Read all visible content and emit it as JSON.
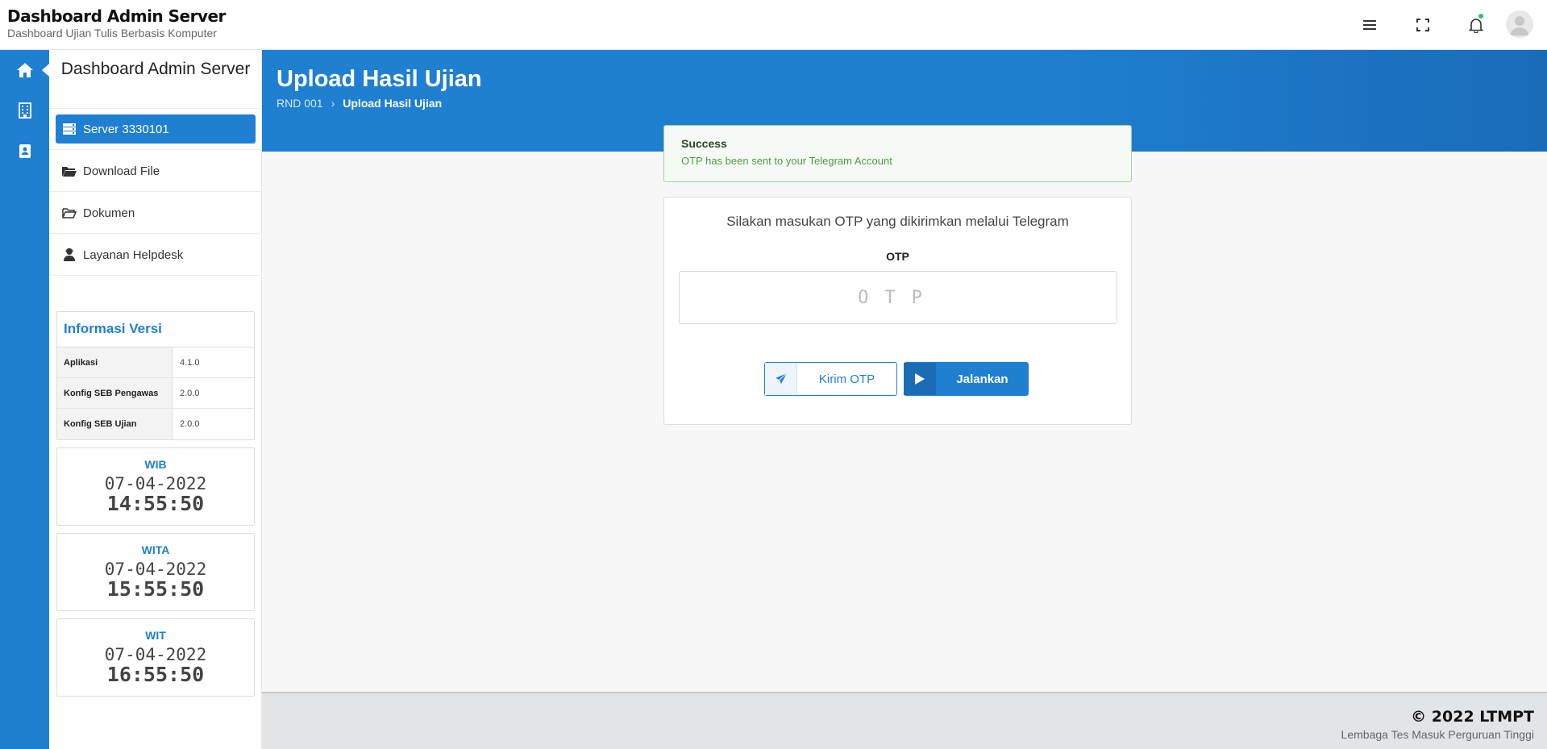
{
  "header": {
    "title": "Dashboard Admin Server",
    "subtitle": "Dashboard Ujian Tulis Berbasis Komputer"
  },
  "rail": {
    "items": [
      {
        "icon": "home-icon",
        "active": true
      },
      {
        "icon": "building-icon",
        "active": false
      },
      {
        "icon": "contact-book-icon",
        "active": false
      }
    ]
  },
  "sidebar": {
    "title": "Dashboard Admin Server",
    "items": [
      {
        "label": "Server 3330101",
        "icon": "server-icon",
        "active": true
      },
      {
        "label": "Download File",
        "icon": "folder-open-icon",
        "active": false
      },
      {
        "label": "Dokumen",
        "icon": "folder-outline-icon",
        "active": false
      },
      {
        "label": "Layanan Helpdesk",
        "icon": "user-headset-icon",
        "active": false
      }
    ],
    "version": {
      "title": "Informasi Versi",
      "rows": [
        {
          "key": "Aplikasi",
          "value": "4.1.0"
        },
        {
          "key": "Konfig SEB Pengawas",
          "value": "2.0.0"
        },
        {
          "key": "Konfig SEB Ujian",
          "value": "2.0.0"
        }
      ]
    },
    "clocks": [
      {
        "zone": "WIB",
        "date": "07-04-2022",
        "time": "14:55:50"
      },
      {
        "zone": "WITA",
        "date": "07-04-2022",
        "time": "15:55:50"
      },
      {
        "zone": "WIT",
        "date": "07-04-2022",
        "time": "16:55:50"
      }
    ]
  },
  "main": {
    "title": "Upload Hasil Ujian",
    "breadcrumb": {
      "root": "RND 001",
      "current": "Upload Hasil Ujian"
    },
    "alert": {
      "title": "Success",
      "message": "OTP has been sent to your Telegram Account"
    },
    "otp": {
      "prompt": "Silakan masukan OTP yang dikirimkan melalui Telegram",
      "label": "OTP",
      "value": "",
      "placeholder": "OTP",
      "send_label": "Kirim OTP",
      "run_label": "Jalankan"
    }
  },
  "footer": {
    "copyright": "© 2022 LTMPT",
    "org": "Lembaga Tes Masuk Perguruan Tinggi"
  },
  "colors": {
    "primary": "#1f7fd1",
    "success_border": "#9fd39a",
    "notif": "#22c55e"
  }
}
